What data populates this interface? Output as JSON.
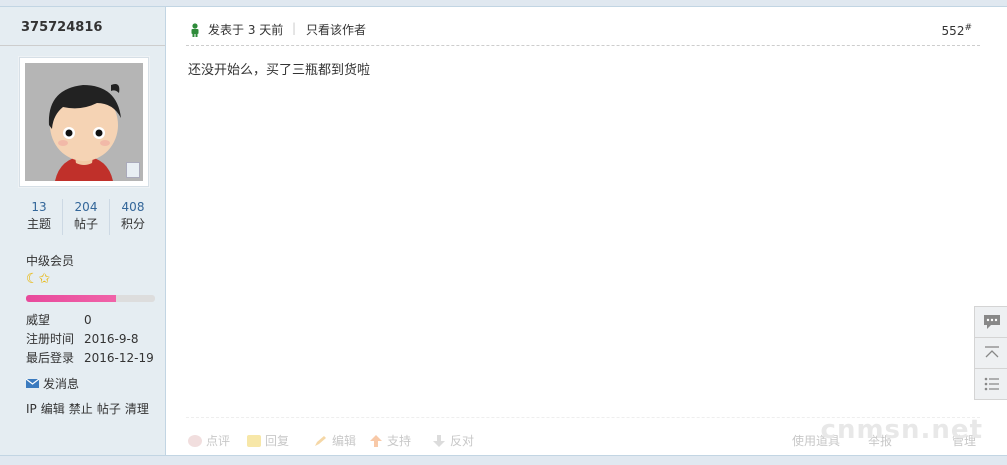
{
  "author": {
    "name": "375724816"
  },
  "stats": [
    {
      "num": "13",
      "label": "主题"
    },
    {
      "num": "204",
      "label": "帖子"
    },
    {
      "num": "408",
      "label": "积分"
    }
  ],
  "rank": {
    "title": "中级会员",
    "icons": "☾✩",
    "progress": 0.7
  },
  "info": {
    "prestige_label": "威望",
    "prestige_value": "0",
    "reg_label": "注册时间",
    "reg_value": "2016-9-8",
    "last_label": "最后登录",
    "last_value": "2016-12-19"
  },
  "send_message": "发消息",
  "admin_links": [
    "IP",
    "编辑",
    "禁止",
    "帖子",
    "清理"
  ],
  "post": {
    "posted": "发表于 3 天前",
    "pipe": "|",
    "author_only": "只看该作者",
    "floor": "552",
    "floor_mark": "#",
    "content": "还没开始么，买了三瓶都到货啦"
  },
  "footer": {
    "rate": "点评",
    "reply": "回复",
    "edit": "编辑",
    "support": "支持",
    "oppose": "反对",
    "tools": "使用道具",
    "report": "举报",
    "manage": "管理"
  },
  "watermark": "cnmsn.net",
  "colors": {
    "sidebar_bg": "#e5edf2",
    "link": "#336699",
    "progress": "#e84a9c"
  }
}
